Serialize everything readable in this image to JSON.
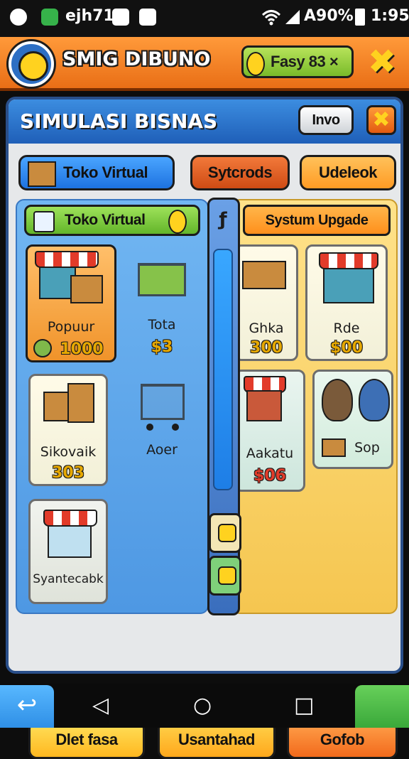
{
  "status_bar": {
    "left_text": "ejh71",
    "battery_text": "A90%",
    "time": "1:95"
  },
  "header": {
    "title": "SMIG DIBUNO",
    "currency_label": "Fasy 83 ×",
    "close_glyph": "✖"
  },
  "panel": {
    "title": "SIMULASI BISNAS",
    "info_label": "Invo",
    "close_glyph": "✖"
  },
  "tabs": [
    {
      "label": "Toko Virtual",
      "active": true
    },
    {
      "label": "Sytcrods",
      "active": false
    },
    {
      "label": "Udeleok",
      "active": false
    }
  ],
  "left_section": {
    "tab_label": "Toko Virtual",
    "items": [
      {
        "label": "Popuur",
        "value": "1000",
        "selected": true
      },
      {
        "label": "Tota",
        "value": "$3",
        "selected": false
      },
      {
        "label": "Sikovaik",
        "value": "303",
        "selected": false
      },
      {
        "label": "Aoer",
        "value": "",
        "selected": false
      },
      {
        "label": "Syantecabk",
        "value": "",
        "selected": false
      }
    ]
  },
  "right_section": {
    "banner": "Systum Upgade",
    "items": [
      {
        "label": "Ghka",
        "value": "300"
      },
      {
        "label": "Rde",
        "value": "$00"
      },
      {
        "label": "Aakatu",
        "value": "$06"
      },
      {
        "label": "Sop",
        "value": ""
      }
    ]
  },
  "scroll": {
    "pin_glyph": "ƒ"
  },
  "bottom_buttons": [
    "Dlet fasa",
    "Usantahad",
    "Gofob"
  ],
  "nav": {
    "back_glyph": "↩",
    "back": "◁",
    "home": "○",
    "recents": "□"
  },
  "icons": [
    "clock-icon",
    "app-icon",
    "camera-icon",
    "message-icon",
    "wifi-icon",
    "signal-icon",
    "battery-icon",
    "coin-icon",
    "store-icon",
    "cart-icon",
    "crate-icon",
    "people-icon"
  ],
  "colors": {
    "header_orange": "#f08a2a",
    "panel_blue": "#2f78d4",
    "left_pane_blue": "#5ea8ec",
    "right_pane_yellow": "#f7d16a",
    "value_gold": "#e6a800"
  }
}
